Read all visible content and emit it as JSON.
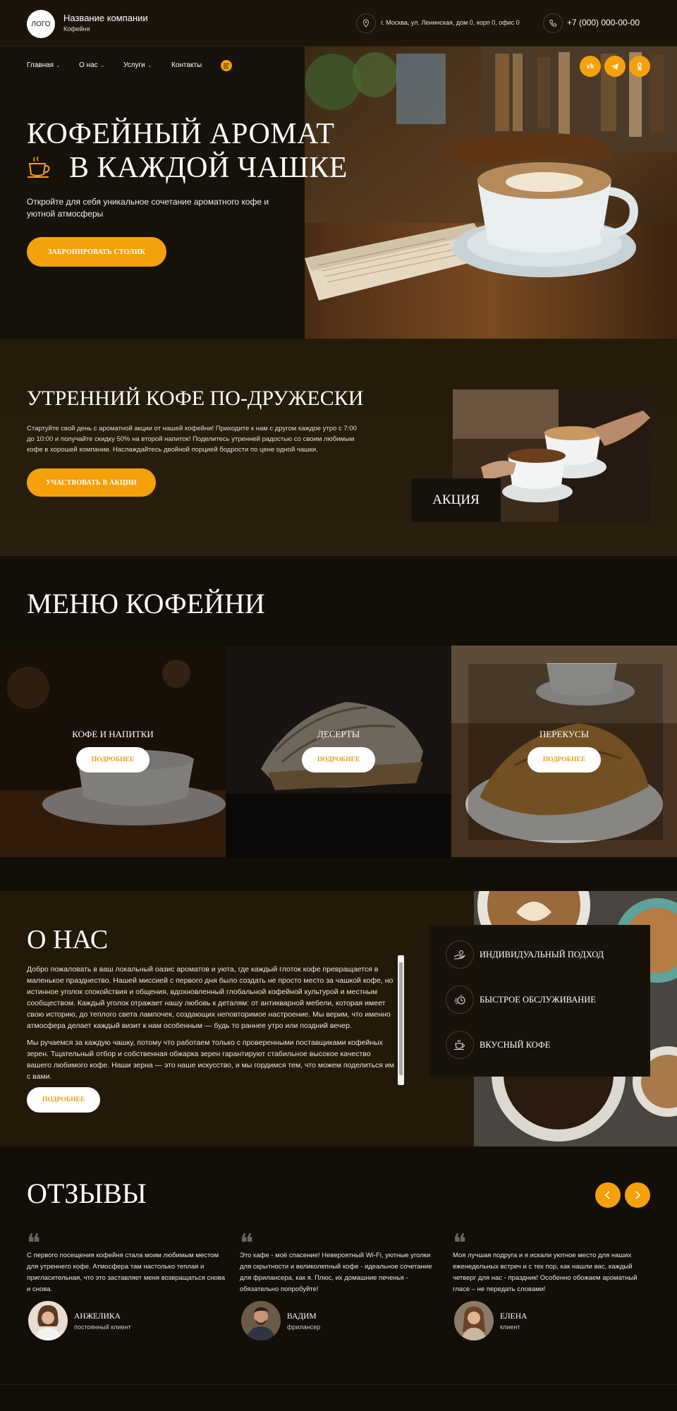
{
  "header": {
    "logo": "ЛОГО",
    "company_name": "Название компании",
    "company_sub": "Кофейня",
    "address": "г. Москва, ул. Ленинская, дом 0, корп 0, офис 0",
    "phone": "+7 (000) 000-00-00"
  },
  "nav": [
    {
      "label": "Главная"
    },
    {
      "label": "О нас"
    },
    {
      "label": "Услуги"
    },
    {
      "label": "Контакты"
    }
  ],
  "social": [
    "vk",
    "tg",
    "ok"
  ],
  "hero": {
    "title_line1": "КОФЕЙНЫЙ АРОМАТ",
    "title_line2": "В КАЖДОЙ ЧАШКЕ",
    "text": "Откройте для себя уникальное сочетание ароматного кофе и уютной атмосферы",
    "button": "ЗАБРОНИРОВАТЬ СТОЛИК"
  },
  "promo": {
    "title": "УТРЕННИЙ КОФЕ ПО-ДРУЖЕСКИ",
    "text": "Стартуйте свой день с ароматной акции от нашей кофейни! Приходите к нам с другом каждое утро с 7:00 до 10:00 и получайте скидку 50% на второй напиток! Поделитесь утренней радостью со своим любимым кофе в хорошей компании. Наслаждайтесь двойной порцией бодрости по цене одной чашки.",
    "button": "УЧАСТВОВАТЬ В АКЦИИ",
    "badge": "АКЦИЯ"
  },
  "menu": {
    "title": "МЕНЮ КОФЕЙНИ",
    "cards": [
      {
        "label": "КОФЕ И НАПИТКИ",
        "button": "ПОДРОБНЕЕ"
      },
      {
        "label": "ДЕСЕРТЫ",
        "button": "ПОДРОБНЕЕ"
      },
      {
        "label": "ПЕРЕКУСЫ",
        "button": "ПОДРОБНЕЕ"
      }
    ]
  },
  "about": {
    "title": "О НАС",
    "paragraph1": "Добро пожаловать в ваш локальный оазис ароматов и уюта, где каждый глоток кофе превращается в маленькое празднество. Нашей миссией с первого дня было создать не просто место за чашкой кофе, но истинное уголок спокойствия и общения, вдохновленный глобальной кофейной культурой и местным сообществом. Каждый уголок отражает нашу любовь к деталям: от антикварной мебели, которая имеет свою историю, до теплого света лампочек, создающих неповторимое настроение. Мы верим, что именно атмосфера делает каждый визит к нам особенным — будь то раннее утро или поздний вечер.",
    "paragraph2": "Мы ручаемся за каждую чашку, потому что работаем только с проверенными поставщиками кофейных зерен. Тщательный отбор и собственная обжарка зерен гарантируют стабильное высокое качество вашего любимого кофе. Наши зерна — это наше искусство, и мы гордимся тем, что можем поделиться им с вами.",
    "button": "ПОДРОБНЕЕ",
    "features": [
      {
        "label": "ИНДИВИДУАЛЬНЫЙ ПОДХОД",
        "icon": "hand-icon"
      },
      {
        "label": "БЫСТРОЕ ОБСЛУЖИВАНИЕ",
        "icon": "fast-icon"
      },
      {
        "label": "ВКУСНЫЙ КОФЕ",
        "icon": "cup-icon"
      }
    ]
  },
  "reviews": {
    "title": "ОТЗЫВЫ",
    "items": [
      {
        "text": "С первого посещения кофейня стала моим любимым местом для утреннего кофе. Атмосфера там настолько теплая и пригласительная, что это заставляет меня возвращаться снова и снова.",
        "name": "АНЖЕЛИКА",
        "role": "постоянный клиент"
      },
      {
        "text": "Это кафе - моё спасение! Невероятный Wi-Fi, уютные уголки для скрытности и великолепный кофе - идеальное сочетание для фрилансера, как я. Плюс, их домашние печенья - обязательно попробуйте!",
        "name": "ВАДИМ",
        "role": "фрилансер"
      },
      {
        "text": "Моя лучшая подруга и я искали уютное место для наших еженедельных встреч и с тех пор, как нашли вас, каждый четверг для нас - праздник! Особенно обожаем ароматный гласе – не передать словами!",
        "name": "ЕЛЕНА",
        "role": "клиент"
      }
    ]
  },
  "colors": {
    "accent": "#f5a10b",
    "dark": "#141008",
    "brown": "#251b0b"
  }
}
